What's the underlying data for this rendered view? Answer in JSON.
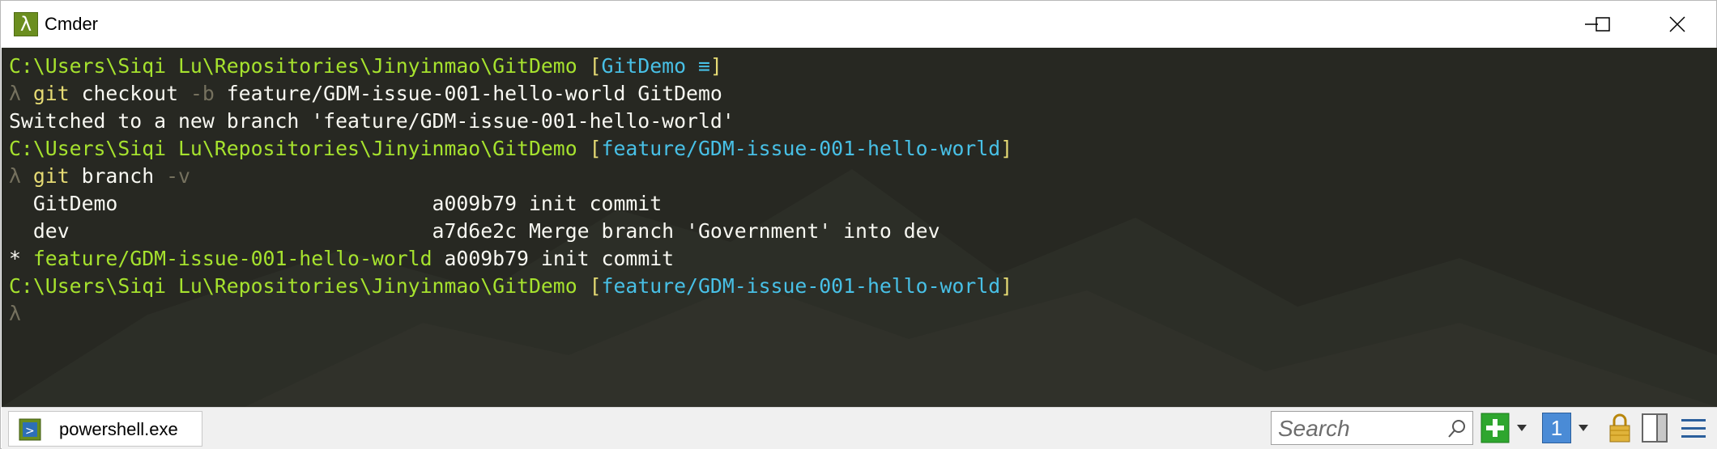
{
  "window": {
    "title": "Cmder",
    "app_icon_glyph": "λ"
  },
  "terminal": {
    "lines": [
      [
        {
          "text": "C:\\Users\\Siqi Lu\\Repositories\\Jinyinmao\\GitDemo ",
          "color": "#a6e22e"
        },
        {
          "text": "[",
          "color": "#e6db74"
        },
        {
          "text": "GitDemo ≡",
          "color": "#48c0e6"
        },
        {
          "text": "]",
          "color": "#e6db74"
        }
      ],
      [
        {
          "text": "λ ",
          "color": "#75715e"
        },
        {
          "text": "git ",
          "color": "#e6db74"
        },
        {
          "text": "checkout ",
          "color": "#f8f8f2"
        },
        {
          "text": "-b ",
          "color": "#75715e"
        },
        {
          "text": "feature/GDM-issue-001-hello-world GitDemo",
          "color": "#f8f8f2"
        }
      ],
      [
        {
          "text": "Switched to a new branch 'feature/GDM-issue-001-hello-world'",
          "color": "#f8f8f2"
        }
      ],
      [
        {
          "text": "C:\\Users\\Siqi Lu\\Repositories\\Jinyinmao\\GitDemo ",
          "color": "#a6e22e"
        },
        {
          "text": "[",
          "color": "#e6db74"
        },
        {
          "text": "feature/GDM-issue-001-hello-world",
          "color": "#48c0e6"
        },
        {
          "text": "]",
          "color": "#e6db74"
        }
      ],
      [
        {
          "text": "λ ",
          "color": "#75715e"
        },
        {
          "text": "git ",
          "color": "#e6db74"
        },
        {
          "text": "branch ",
          "color": "#f8f8f2"
        },
        {
          "text": "-v",
          "color": "#75715e"
        }
      ],
      [
        {
          "text": "  GitDemo                          ",
          "color": "#f8f8f2"
        },
        {
          "text": "a009b79 init commit",
          "color": "#f8f8f2"
        }
      ],
      [
        {
          "text": "  dev                              ",
          "color": "#f8f8f2"
        },
        {
          "text": "a7d6e2c Merge branch 'Government' into dev",
          "color": "#f8f8f2"
        }
      ],
      [
        {
          "text": "* ",
          "color": "#f8f8f2"
        },
        {
          "text": "feature/GDM-issue-001-hello-world",
          "color": "#a6e22e"
        },
        {
          "text": " a009b79 init commit",
          "color": "#f8f8f2"
        }
      ],
      [
        {
          "text": "C:\\Users\\Siqi Lu\\Repositories\\Jinyinmao\\GitDemo ",
          "color": "#a6e22e"
        },
        {
          "text": "[",
          "color": "#e6db74"
        },
        {
          "text": "feature/GDM-issue-001-hello-world",
          "color": "#48c0e6"
        },
        {
          "text": "]",
          "color": "#e6db74"
        }
      ],
      [
        {
          "text": "λ",
          "color": "#75715e"
        }
      ]
    ]
  },
  "statusbar": {
    "tab_label": "powershell.exe",
    "search_placeholder": "Search",
    "console_number": "1"
  },
  "colors": {
    "terminal_bg": "#272822",
    "path_green": "#a6e22e",
    "bracket_yellow": "#e6db74",
    "branch_cyan": "#48c0e6",
    "dim_gray": "#75715e"
  },
  "icons": {
    "minimize": "minimize-icon",
    "maximize": "maximize-icon",
    "close": "close-icon",
    "search": "search-icon",
    "new_console": "plus-icon",
    "lock": "lock-icon",
    "split": "split-view-icon",
    "menu": "hamburger-menu-icon"
  }
}
